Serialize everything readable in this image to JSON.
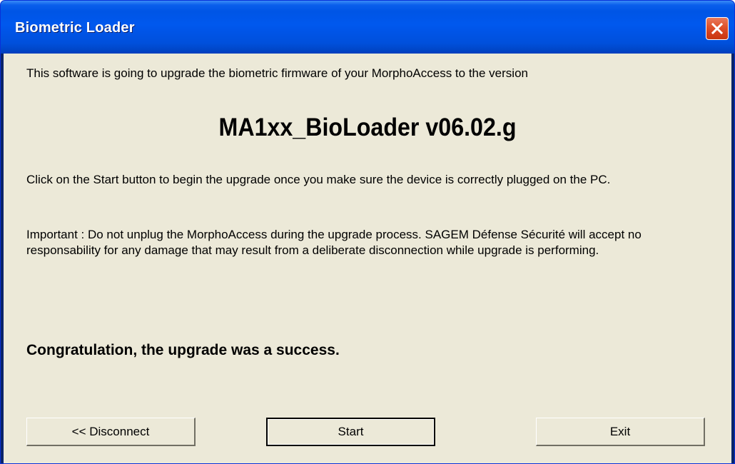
{
  "window": {
    "title": "Biometric Loader"
  },
  "content": {
    "intro": "This software is going to upgrade the biometric firmware of your MorphoAccess to the version",
    "version": "MA1xx_BioLoader v06.02.g",
    "instructions": "Click on the Start button to begin the upgrade once you make sure the device is correctly plugged on the PC.",
    "important": "Important : Do not unplug the MorphoAccess during the upgrade process. SAGEM Défense Sécurité will accept no responsability for any damage that may result from a deliberate disconnection while upgrade is performing.",
    "status": "Congratulation, the upgrade was a success."
  },
  "buttons": {
    "disconnect": "<< Disconnect",
    "start": "Start",
    "exit": "Exit"
  },
  "icons": {
    "close": "close-icon"
  },
  "colors": {
    "titlebar": "#0054e6",
    "close_button": "#e0542d",
    "client_bg": "#ece9d8"
  }
}
